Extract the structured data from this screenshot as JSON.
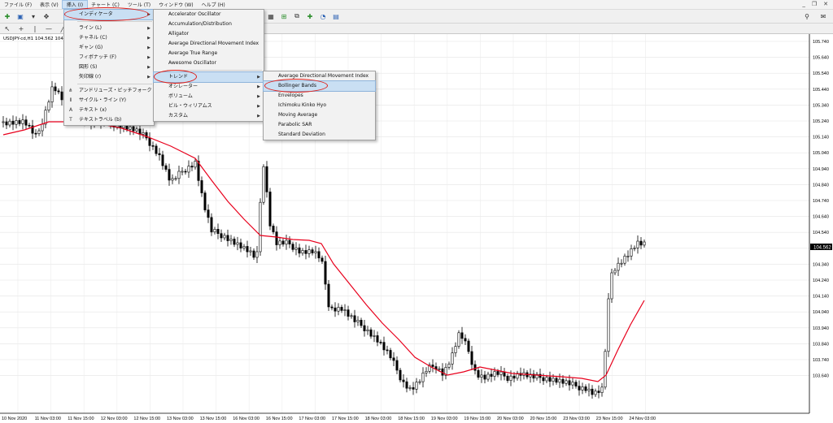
{
  "menubar": {
    "items": [
      "ファイル (F)",
      "表示 (V)",
      "挿入 (I)",
      "チャート (C)",
      "ツール (T)",
      "ウィンドウ (W)",
      "ヘルプ (H)"
    ]
  },
  "window_controls": [
    "_",
    "❐",
    "✕"
  ],
  "chart": {
    "symbol_label": "USDJPY-cd,H1  104.562 104",
    "current_price": "104.562",
    "price_ticks": [
      "105.740",
      "105.640",
      "105.540",
      "105.440",
      "105.340",
      "105.240",
      "105.140",
      "105.040",
      "104.940",
      "104.840",
      "104.740",
      "104.640",
      "104.540",
      "104.440",
      "104.340",
      "104.240",
      "104.140",
      "104.040",
      "103.940",
      "103.840",
      "103.740",
      "103.640"
    ],
    "time_ticks": [
      "10 Nov 2020",
      "11 Nov 03:00",
      "11 Nov 15:00",
      "12 Nov 03:00",
      "12 Nov 15:00",
      "13 Nov 03:00",
      "13 Nov 15:00",
      "16 Nov 03:00",
      "16 Nov 15:00",
      "17 Nov 03:00",
      "17 Nov 15:00",
      "18 Nov 03:00",
      "18 Nov 15:00",
      "19 Nov 03:00",
      "19 Nov 15:00",
      "20 Nov 03:00",
      "20 Nov 15:00",
      "23 Nov 03:00",
      "23 Nov 15:00",
      "24 Nov 03:00"
    ],
    "ma_color": "#e8001c",
    "candle_color": "#000000"
  },
  "insert_menu": {
    "items": [
      {
        "label": "インディケータ",
        "has_sub": true,
        "highlight": true
      },
      {
        "sep": true
      },
      {
        "label": "ライン (L)",
        "has_sub": true
      },
      {
        "label": "チャネル (C)",
        "has_sub": true
      },
      {
        "label": "ギャン (G)",
        "has_sub": true
      },
      {
        "label": "フィボナッチ (F)",
        "has_sub": true
      },
      {
        "label": "図形 (S)",
        "has_sub": true
      },
      {
        "label": "矢印線 (r)",
        "has_sub": true
      },
      {
        "sep": true
      },
      {
        "label": "アンドリューズ・ピッチフォーク (A)",
        "icon": "pitchfork-icon",
        "glyph": "⋔"
      },
      {
        "label": "サイクル・ライン (Y)",
        "icon": "cycle-lines-icon",
        "glyph": "⦀"
      },
      {
        "label": "テキスト (x)",
        "icon": "text-icon",
        "glyph": "A"
      },
      {
        "label": "テキストラベル (b)",
        "icon": "text-label-icon",
        "glyph": "T"
      }
    ]
  },
  "indicator_menu": {
    "items": [
      {
        "label": "Accelerator Oscillator"
      },
      {
        "label": "Accumulation/Distribution"
      },
      {
        "label": "Alligator"
      },
      {
        "label": "Average Directional Movement Index"
      },
      {
        "label": "Average True Range"
      },
      {
        "label": "Awesome Oscillator"
      },
      {
        "sep": true
      },
      {
        "label": "トレンド",
        "has_sub": true,
        "highlight": true
      },
      {
        "label": "オシレーター",
        "has_sub": true
      },
      {
        "label": "ボリューム",
        "has_sub": true
      },
      {
        "label": "ビル・ウィリアムス",
        "has_sub": true
      },
      {
        "label": "カスタム",
        "has_sub": true
      }
    ]
  },
  "trend_menu": {
    "items": [
      {
        "label": "Average Directional Movement Index"
      },
      {
        "label": "Bollinger Bands",
        "highlight": true
      },
      {
        "label": "Envelopes"
      },
      {
        "label": "Ichimoku Kinko Hyo"
      },
      {
        "label": "Moving Average"
      },
      {
        "label": "Parabolic SAR"
      },
      {
        "label": "Standard Deviation"
      }
    ]
  }
}
